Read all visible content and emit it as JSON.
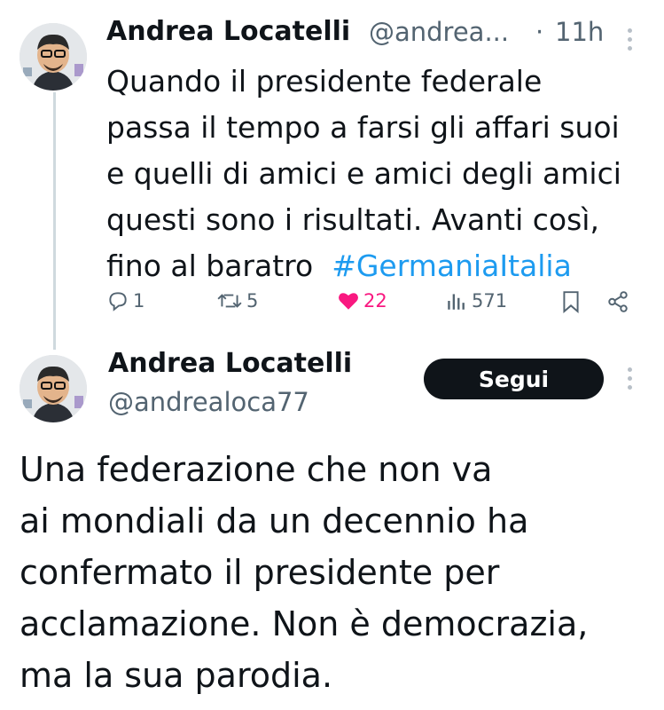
{
  "tweet": {
    "author_name": "Andrea Locatelli",
    "author_handle_truncated": "@andrea...",
    "separator": "·",
    "time": "11h",
    "text_lines": [
      "Quando il presidente federale",
      "passa il tempo a farsi gli affari suoi",
      "e quelli di amici e amici degli amici",
      "questi sono i risultati. Avanti così,",
      "fino al baratro"
    ],
    "hashtag": "#GermaniaItalia",
    "replies": "1",
    "reposts": "5",
    "likes": "22",
    "views": "571",
    "colors": {
      "hashtag": "#1d9bf0",
      "like": "#f91880",
      "muted": "#536471"
    }
  },
  "profile": {
    "name": "Andrea Locatelli",
    "handle": "@andrealoca77",
    "follow_label": "Segui"
  },
  "post": {
    "text_lines": [
      "Una federazione che non va",
      "ai mondiali da un decennio ha",
      "confermato il presidente per",
      "acclamazione. Non è democrazia,",
      "ma la sua parodia."
    ]
  },
  "icons": [
    "avatar",
    "kebab-icon",
    "reply-icon",
    "repost-icon",
    "heart-icon",
    "views-icon",
    "bookmark-icon",
    "share-icon"
  ]
}
